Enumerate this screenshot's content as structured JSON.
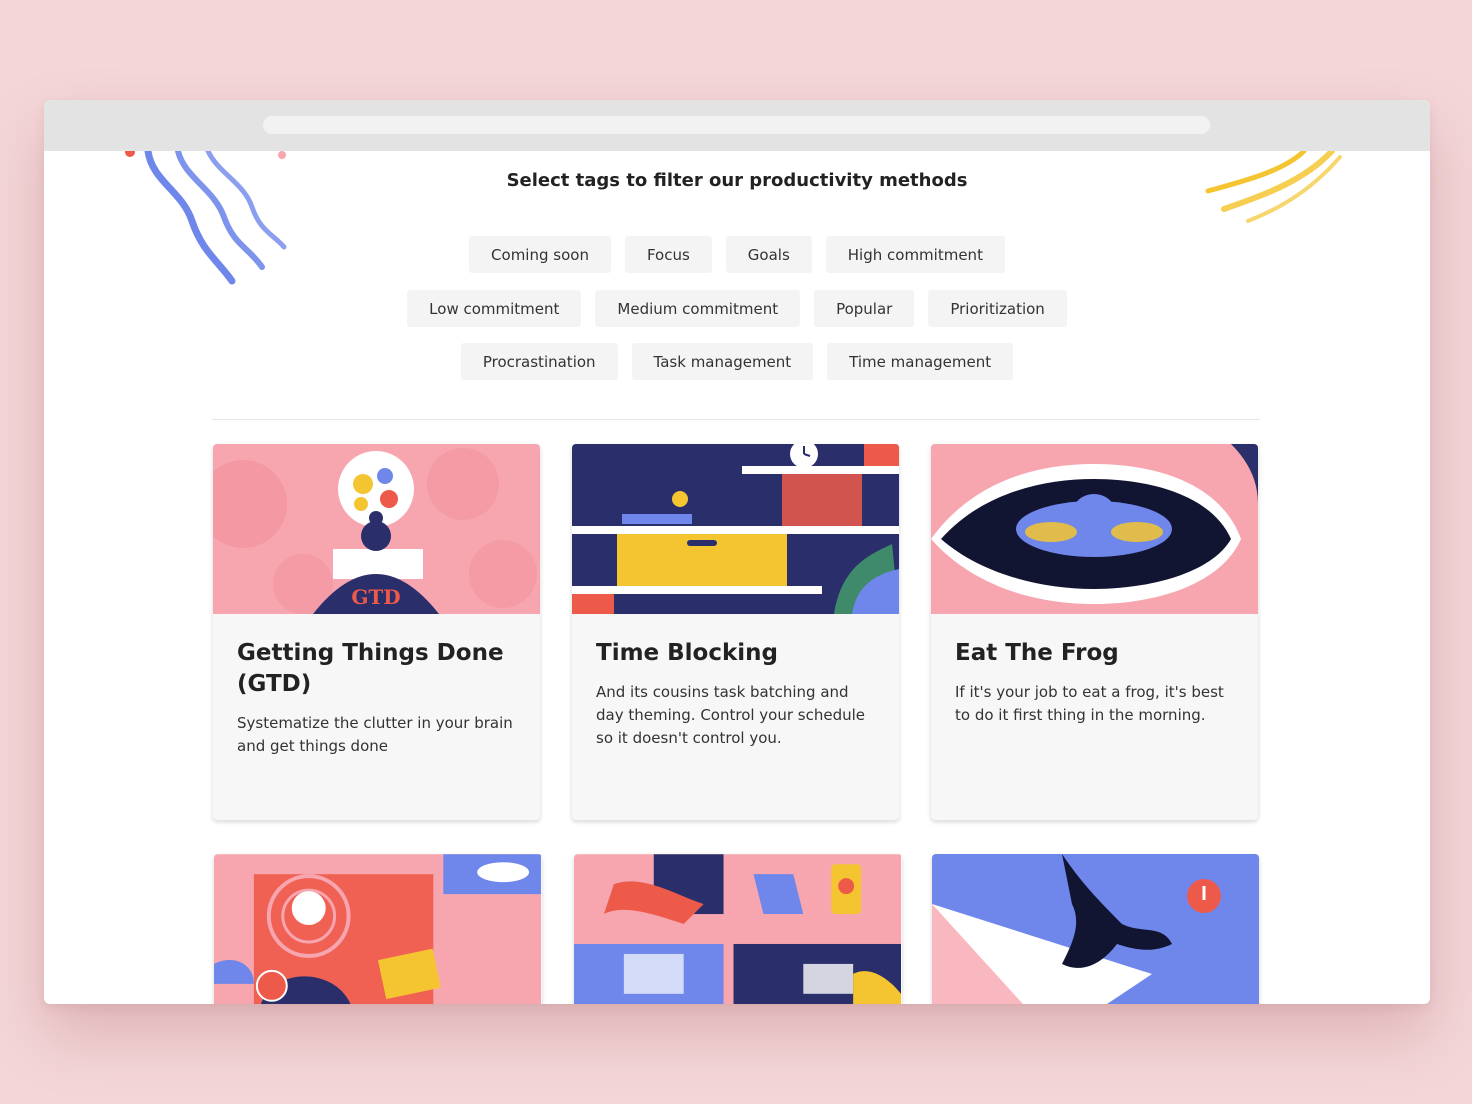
{
  "page": {
    "heading": "Select tags to filter our productivity methods"
  },
  "tags": {
    "row1": [
      "Coming soon",
      "Focus",
      "Goals",
      "High commitment"
    ],
    "row2": [
      "Low commitment",
      "Medium commitment",
      "Popular",
      "Prioritization"
    ],
    "row3": [
      "Procrastination",
      "Task management",
      "Time management"
    ]
  },
  "cards": [
    {
      "title": "Getting Things Done (GTD)",
      "description": "Systematize the clutter in your brain and get things done",
      "illustration_text": "GTD"
    },
    {
      "title": "Time Blocking",
      "description": "And its cousins task batching and day theming. Control your schedule so it doesn't control you."
    },
    {
      "title": "Eat The Frog",
      "description": "If it's your job to eat a frog, it's best to do it first thing in the morning."
    }
  ],
  "colors": {
    "page_background": "#f4d6d8",
    "browser_chrome": "#e3e3e3",
    "tag_background": "#f4f4f4",
    "card_background": "#f7f7f7",
    "illustration_pink": "#f7a6b0",
    "illustration_navy": "#2a2f6b",
    "illustration_blue": "#6f87ea",
    "illustration_yellow": "#f4c531",
    "illustration_red": "#ee5a4a"
  }
}
